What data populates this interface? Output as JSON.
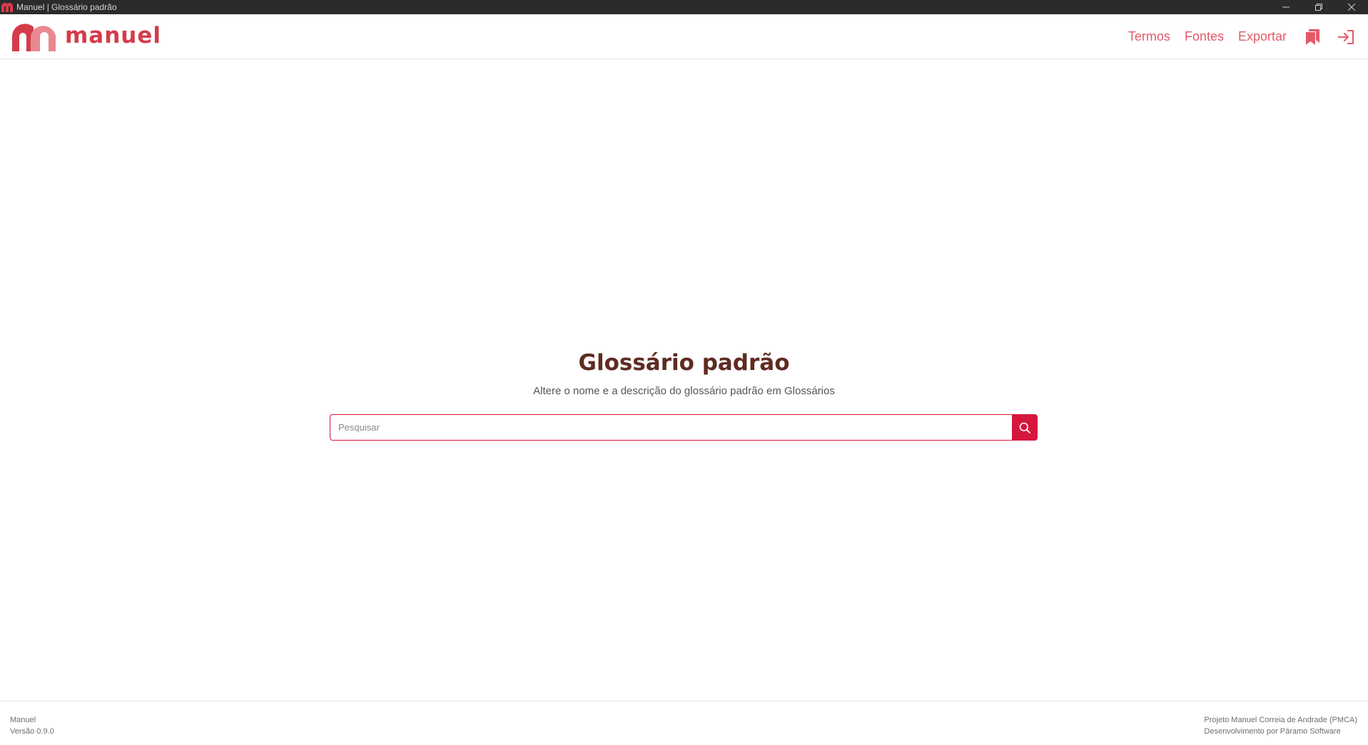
{
  "window": {
    "title": "Manuel | Glossário padrão",
    "controls": [
      "minimize-icon",
      "restore-icon",
      "close-icon"
    ]
  },
  "header": {
    "logo_text": "manuel",
    "nav": {
      "terms": "Termos",
      "sources": "Fontes",
      "export": "Exportar"
    },
    "icons": [
      "bookmark-icon",
      "logout-icon"
    ]
  },
  "main": {
    "title": "Glossário padrão",
    "subtitle": "Altere o nome e a descrição do glossário padrão em Glossários",
    "search": {
      "placeholder": "Pesquisar",
      "value": "",
      "button_icon": "search-icon"
    }
  },
  "footer": {
    "app_name": "Manuel",
    "version": "Versão 0.9.0",
    "project": "Projeto Manuel Correia de Andrade (PMCA)",
    "developer": "Desenvolvimento por Páramo Software"
  },
  "colors": {
    "accent": "#d6173d",
    "nav_text": "#e35a68",
    "logo": "#d63b4a",
    "title": "#5e2b20",
    "titlebar_bg": "#2b2b2b"
  }
}
